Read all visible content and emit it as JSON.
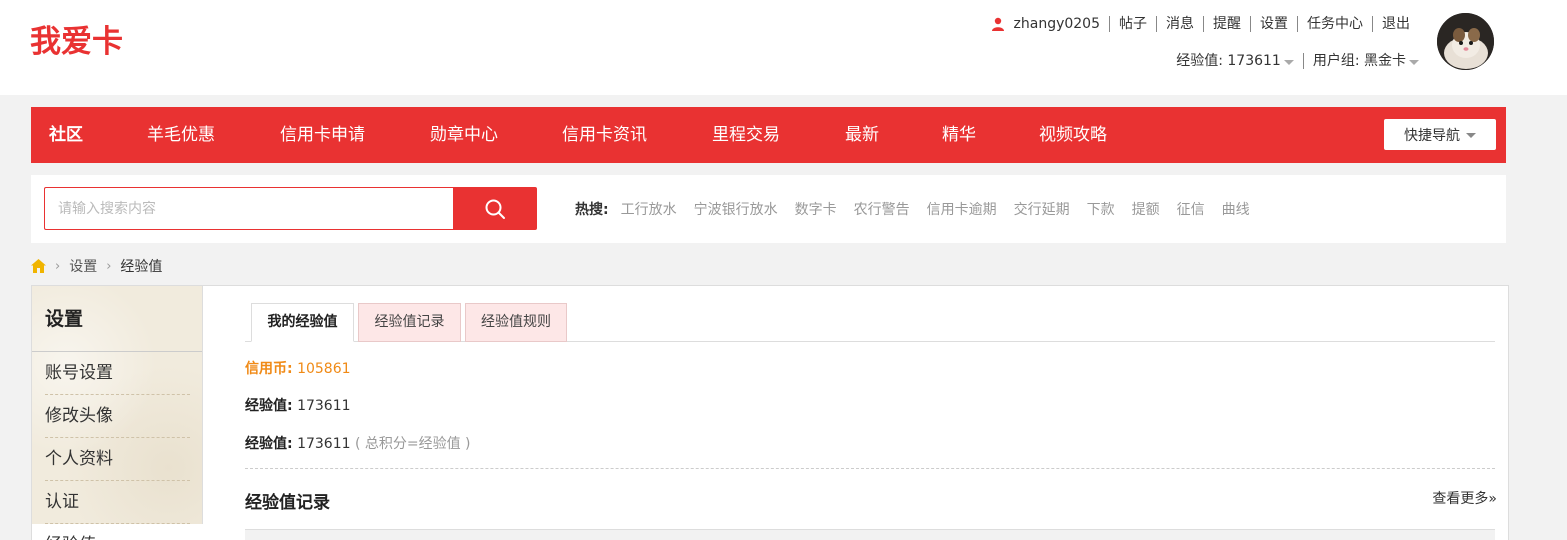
{
  "logo": {
    "text": "我爱卡",
    "color": "#e93232"
  },
  "user": {
    "username": "zhangy0205",
    "links": [
      "帖子",
      "消息",
      "提醒",
      "设置",
      "任务中心",
      "退出"
    ],
    "exp_label": "经验值:",
    "exp_value": "173611",
    "group_label": "用户组:",
    "group_value": "黑金卡"
  },
  "nav": {
    "items": [
      "社区",
      "羊毛优惠",
      "信用卡申请",
      "勋章中心",
      "信用卡资讯",
      "里程交易",
      "最新",
      "精华",
      "视频攻略"
    ],
    "quick_nav": "快捷导航",
    "accent": "#e93232"
  },
  "search": {
    "placeholder": "请输入搜索内容",
    "hot_label": "热搜:",
    "hot_keywords": [
      "工行放水",
      "宁波银行放水",
      "数字卡",
      "农行警告",
      "信用卡逾期",
      "交行延期",
      "下款",
      "提额",
      "征信",
      "曲线"
    ]
  },
  "breadcrumb": {
    "items": [
      "设置",
      "经验值"
    ]
  },
  "sidebar": {
    "title": "设置",
    "items": [
      "账号设置",
      "修改头像",
      "个人资料",
      "认证",
      "经验值"
    ]
  },
  "tabs": [
    "我的经验值",
    "经验值记录",
    "经验值规则"
  ],
  "info": {
    "coin_label": "信用币:",
    "coin_value": "105861",
    "exp_label": "经验值:",
    "exp_value": "173611",
    "exp2_label": "经验值:",
    "exp2_value": "173611",
    "exp2_note": "( 总积分=经验值 )"
  },
  "records": {
    "title": "经验值记录",
    "more": "查看更多»"
  }
}
